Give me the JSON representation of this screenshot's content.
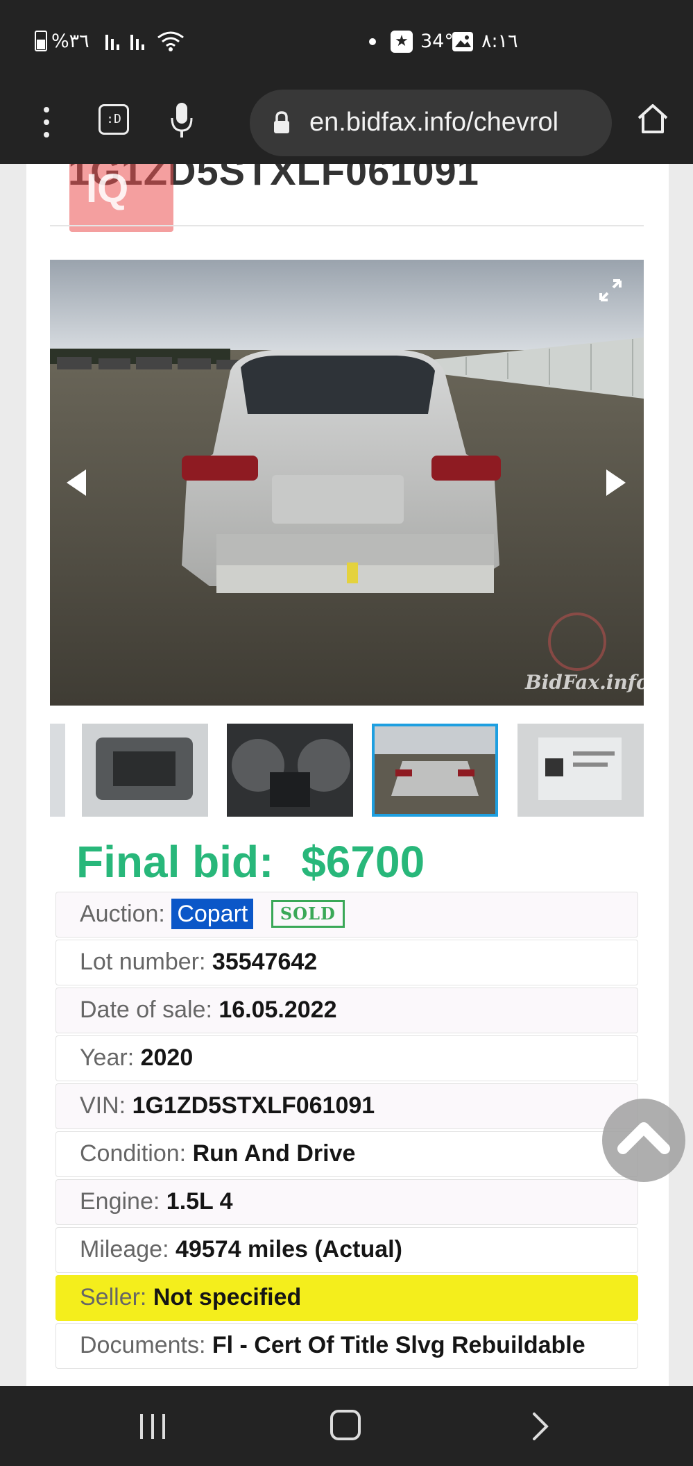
{
  "status_bar": {
    "battery": "%٣٦",
    "temperature": "34°",
    "time": "٨:١٦"
  },
  "browser": {
    "url": "en.bidfax.info/chevrol"
  },
  "listing": {
    "vin_title": "1G1ZD5STXLF061091",
    "logo_text": "IQ",
    "watermark": "BidFax.info",
    "final_bid_label": "Final bid:",
    "final_bid_value": "$6700",
    "auction_label": "Auction:",
    "auction_value": "Copart",
    "sold_badge": "SOLD",
    "lot_label": "Lot number:",
    "lot_value": "35547642",
    "date_label": "Date of sale:",
    "date_value": "16.05.2022",
    "year_label": "Year:",
    "year_value": "2020",
    "vin_label": "VIN:",
    "vin_value": "1G1ZD5STXLF061091",
    "condition_label": "Condition:",
    "condition_value": "Run And Drive",
    "engine_label": "Engine:",
    "engine_value": "1.5L 4",
    "mileage_label": "Mileage:",
    "mileage_value": "49574 miles (Actual)",
    "seller_label": "Seller:",
    "seller_value": "Not specified",
    "documents_label": "Documents:",
    "documents_value": "Fl - Cert Of Title Slvg Rebuildable"
  },
  "colors": {
    "final_bid": "#28b77a",
    "copart": "#0b57c8",
    "seller_highlight": "#f4ee1c",
    "selected_thumb": "#1e9fe0"
  }
}
